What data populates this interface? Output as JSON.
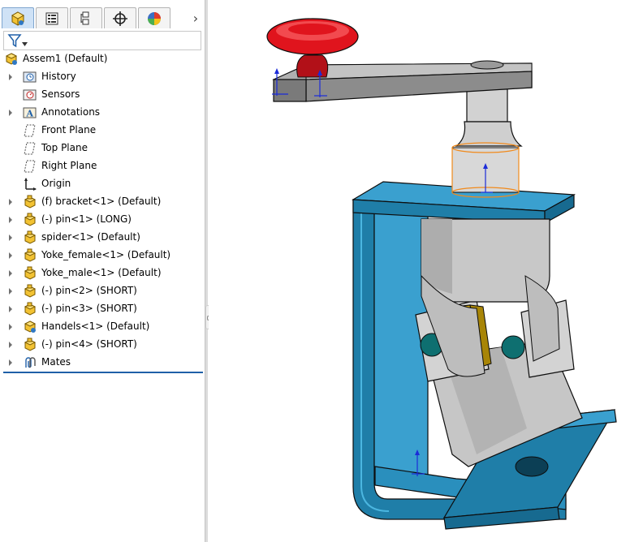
{
  "tree": {
    "root": {
      "label": "Assem1  (Default)",
      "icon": "assembly-icon"
    },
    "items": [
      {
        "label": "History",
        "icon": "history-icon",
        "expandable": true
      },
      {
        "label": "Sensors",
        "icon": "sensor-icon",
        "expandable": false
      },
      {
        "label": "Annotations",
        "icon": "annotations-icon",
        "expandable": true
      },
      {
        "label": "Front Plane",
        "icon": "plane-icon",
        "expandable": false
      },
      {
        "label": "Top Plane",
        "icon": "plane-icon",
        "expandable": false
      },
      {
        "label": "Right Plane",
        "icon": "plane-icon",
        "expandable": false
      },
      {
        "label": "Origin",
        "icon": "origin-icon",
        "expandable": false
      },
      {
        "label": "(f) bracket<1> (Default)",
        "icon": "part-icon",
        "expandable": true
      },
      {
        "label": "(-) pin<1> (LONG)",
        "icon": "part-icon",
        "expandable": true
      },
      {
        "label": "spider<1> (Default)",
        "icon": "part-icon",
        "expandable": true
      },
      {
        "label": "Yoke_female<1> (Default)",
        "icon": "part-icon",
        "expandable": true
      },
      {
        "label": "Yoke_male<1> (Default)",
        "icon": "part-icon",
        "expandable": true
      },
      {
        "label": "(-) pin<2> (SHORT)",
        "icon": "part-icon",
        "expandable": true
      },
      {
        "label": "(-) pin<3> (SHORT)",
        "icon": "part-icon",
        "expandable": true
      },
      {
        "label": "Handels<1> (Default)",
        "icon": "subassembly-icon",
        "expandable": true
      },
      {
        "label": "(-) pin<4> (SHORT)",
        "icon": "part-icon",
        "expandable": true
      },
      {
        "label": "Mates",
        "icon": "mates-icon",
        "expandable": true
      }
    ]
  },
  "tabs": [
    {
      "name": "featuremanager-tab",
      "active": true
    },
    {
      "name": "propertymanager-tab",
      "active": false
    },
    {
      "name": "configurationmanager-tab",
      "active": false
    },
    {
      "name": "dimxpertmanager-tab",
      "active": false
    },
    {
      "name": "displaymanager-tab",
      "active": false
    }
  ],
  "tab_more_label": "›",
  "colors": {
    "bracket": "#3aa0cf",
    "knob": "#e0141d",
    "metal": "#c6c6c6",
    "yoke_gold": "#d9ae12",
    "pin_teal": "#0e6f70",
    "selection": "#f18a1c",
    "tree_divider": "#1f5fa8"
  }
}
